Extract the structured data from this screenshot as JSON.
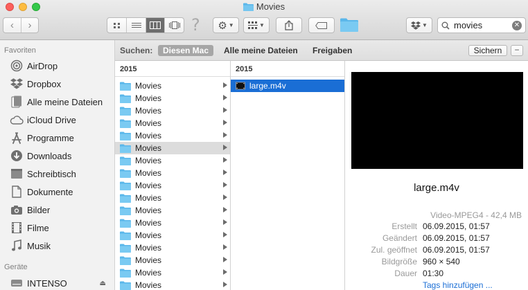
{
  "window": {
    "title": "Movies"
  },
  "toolbar": {
    "help_glyph": "?",
    "search_value": "movies",
    "clear_glyph": "✕"
  },
  "sidebar": {
    "favorites_header": "Favoriten",
    "favorites": [
      {
        "label": "AirDrop",
        "icon": "airdrop-icon"
      },
      {
        "label": "Dropbox",
        "icon": "dropbox-icon"
      },
      {
        "label": "Alle meine Dateien",
        "icon": "all-files-icon"
      },
      {
        "label": "iCloud Drive",
        "icon": "icloud-icon"
      },
      {
        "label": "Programme",
        "icon": "applications-icon"
      },
      {
        "label": "Downloads",
        "icon": "downloads-icon"
      },
      {
        "label": "Schreibtisch",
        "icon": "desktop-icon"
      },
      {
        "label": "Dokumente",
        "icon": "documents-icon"
      },
      {
        "label": "Bilder",
        "icon": "pictures-icon"
      },
      {
        "label": "Filme",
        "icon": "movies-icon"
      },
      {
        "label": "Musik",
        "icon": "music-icon"
      }
    ],
    "devices_header": "Geräte",
    "devices": [
      {
        "label": "INTENSO",
        "icon": "drive-icon"
      }
    ]
  },
  "scope": {
    "label": "Suchen:",
    "options": [
      "Diesen Mac",
      "Alle meine Dateien",
      "Freigaben"
    ],
    "active": "Diesen Mac",
    "save_label": "Sichern",
    "remove_label": "−"
  },
  "columns": {
    "col1_header": "2015",
    "col1_rows": [
      "Movies",
      "Movies",
      "Movies",
      "Movies",
      "Movies",
      "Movies",
      "Movies",
      "Movies",
      "Movies",
      "Movies",
      "Movies",
      "Movies",
      "Movies",
      "Movies",
      "Movies",
      "Movies",
      "Movies"
    ],
    "col1_selected_index": 5,
    "col2_header": "2015",
    "col2_rows": [
      "large.m4v"
    ]
  },
  "preview": {
    "name": "large.m4v",
    "kind": "Video-MPEG4 - 42,4 MB",
    "details": [
      {
        "key": "Erstellt",
        "value": "06.09.2015, 01:57"
      },
      {
        "key": "Geändert",
        "value": "06.09.2015, 01:57"
      },
      {
        "key": "Zul. geöffnet",
        "value": "06.09.2015, 01:57"
      },
      {
        "key": "Bildgröße",
        "value": "960 × 540"
      },
      {
        "key": "Dauer",
        "value": "01:30"
      }
    ],
    "tags_link": "Tags hinzufügen ..."
  },
  "colors": {
    "selection": "#1a6ed5",
    "folder": "#5ab7ea"
  }
}
